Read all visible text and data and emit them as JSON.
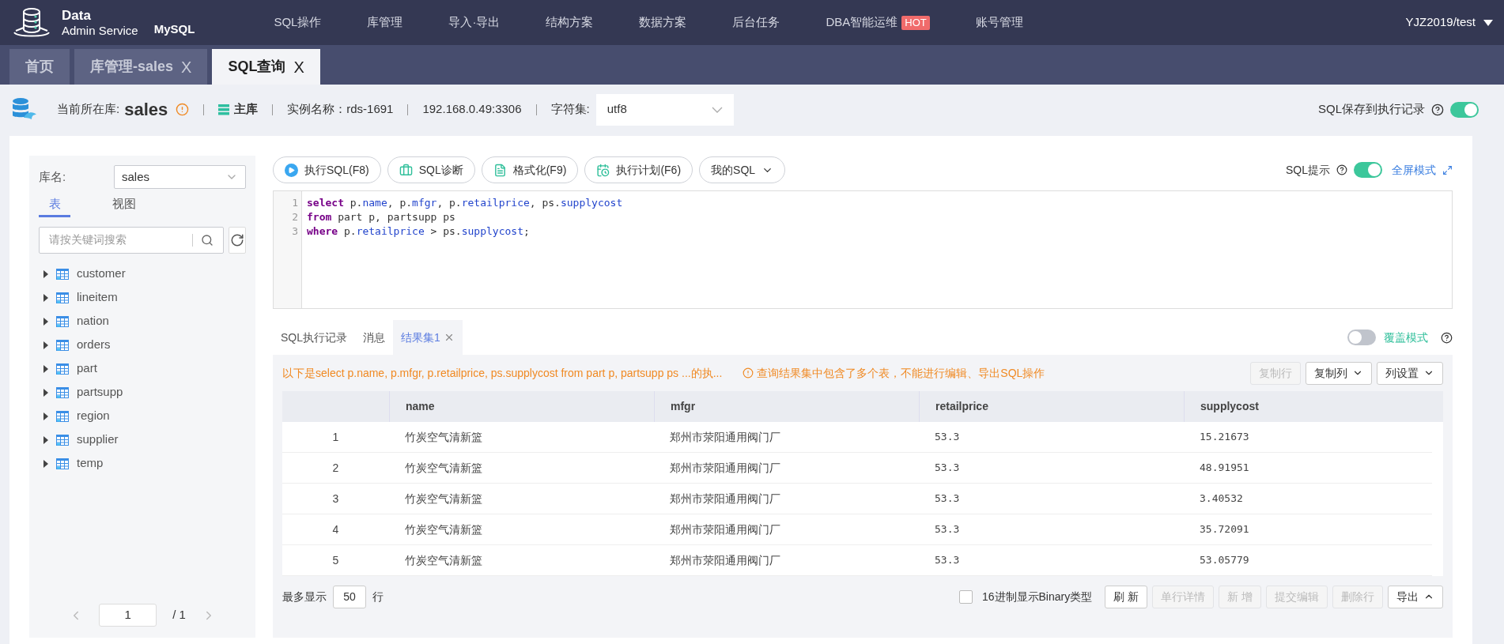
{
  "header": {
    "brand_line1": "Data",
    "brand_line2": "Admin Service",
    "brand_db": "MySQL",
    "menu": [
      {
        "label": "SQL操作"
      },
      {
        "label": "库管理"
      },
      {
        "label": "导入·导出"
      },
      {
        "label": "结构方案"
      },
      {
        "label": "数据方案"
      },
      {
        "label": "后台任务"
      },
      {
        "label": "DBA智能运维",
        "badge": "HOT"
      },
      {
        "label": "账号管理"
      }
    ],
    "user": "YJZ2019/test"
  },
  "page_tabs": [
    {
      "label": "首页",
      "selected": false,
      "closable": false
    },
    {
      "label": "库管理-sales",
      "selected": false,
      "closable": true,
      "close": "X"
    },
    {
      "label": "SQL查询",
      "selected": true,
      "closable": true,
      "close": "X"
    }
  ],
  "info_bar": {
    "db_label": "当前所在库:",
    "db_name": "sales",
    "role": "主库",
    "instance": "实例名称：rds-1691",
    "address": "192.168.0.49:3306",
    "charset_label": "字符集:",
    "charset": "utf8",
    "save_log_label": "SQL保存到执行记录",
    "save_log_on": true
  },
  "sidebar": {
    "db_label": "库名:",
    "db_value": "sales",
    "tabs": [
      {
        "label": "表",
        "selected": true
      },
      {
        "label": "视图",
        "selected": false
      }
    ],
    "search_placeholder": "请按关键词搜索",
    "tables": [
      {
        "name": "customer",
        "expanded": false
      },
      {
        "name": "lineitem",
        "expanded": false
      },
      {
        "name": "nation",
        "expanded": false
      },
      {
        "name": "orders",
        "expanded": false
      },
      {
        "name": "part",
        "expanded": false
      },
      {
        "name": "partsupp",
        "expanded": false
      },
      {
        "name": "region",
        "expanded": false
      },
      {
        "name": "supplier",
        "expanded": false
      },
      {
        "name": "temp",
        "expanded": false
      }
    ],
    "pager": {
      "page": "1",
      "total": "/ 1"
    }
  },
  "toolbar": {
    "buttons": [
      {
        "label": "执行SQL(F8)",
        "dropdown": false
      },
      {
        "label": "SQL诊断",
        "dropdown": false
      },
      {
        "label": "格式化(F9)",
        "dropdown": false
      },
      {
        "label": "执行计划(F6)",
        "dropdown": false
      },
      {
        "label": "我的SQL",
        "dropdown": true
      }
    ],
    "hint_label": "SQL提示",
    "hint_on": true,
    "fullscreen": "全屏模式"
  },
  "editor": {
    "lines": [
      {
        "number": "1",
        "tokens": [
          {
            "kind": "keyword",
            "text": "select"
          },
          {
            "kind": "plain",
            "text": " p."
          },
          {
            "kind": "field",
            "text": "name"
          },
          {
            "kind": "plain",
            "text": ", p."
          },
          {
            "kind": "field",
            "text": "mfgr"
          },
          {
            "kind": "plain",
            "text": ", p."
          },
          {
            "kind": "field",
            "text": "retailprice"
          },
          {
            "kind": "plain",
            "text": ", ps."
          },
          {
            "kind": "field",
            "text": "supplycost"
          }
        ]
      },
      {
        "number": "2",
        "tokens": [
          {
            "kind": "keyword",
            "text": "from"
          },
          {
            "kind": "plain",
            "text": " part p, partsupp ps"
          }
        ]
      },
      {
        "number": "3",
        "tokens": [
          {
            "kind": "keyword",
            "text": "where"
          },
          {
            "kind": "plain",
            "text": " p."
          },
          {
            "kind": "field",
            "text": "retailprice"
          },
          {
            "kind": "plain",
            "text": " > ps."
          },
          {
            "kind": "field",
            "text": "supplycost"
          },
          {
            "kind": "plain",
            "text": ";"
          }
        ]
      }
    ]
  },
  "result_tabs": [
    {
      "label": "SQL执行记录",
      "selected": false,
      "closable": false
    },
    {
      "label": "消息",
      "selected": false,
      "closable": false
    },
    {
      "label": "结果集1",
      "selected": true,
      "closable": true
    }
  ],
  "overwrite_mode": {
    "label": "覆盖模式",
    "on": false
  },
  "result_info": {
    "summary": "以下是select p.name, p.mfgr, p.retailprice, ps.supplycost from part p, partsupp ps ...的执...",
    "warning": "查询结果集中包含了多个表，不能进行编辑、导出SQL操作",
    "actions": [
      {
        "label": "复制行",
        "disabled": true,
        "dropdown": false
      },
      {
        "label": "复制列",
        "disabled": false,
        "dropdown": true
      },
      {
        "label": "列设置",
        "disabled": false,
        "dropdown": true
      }
    ]
  },
  "table": {
    "columns": [
      "",
      "name",
      "mfgr",
      "retailprice",
      "supplycost"
    ],
    "rows": [
      [
        "1",
        "竹炭空气清新篮",
        "郑州市荥阳通用阀门厂",
        "53.3",
        "15.21673"
      ],
      [
        "2",
        "竹炭空气清新篮",
        "郑州市荥阳通用阀门厂",
        "53.3",
        "48.91951"
      ],
      [
        "3",
        "竹炭空气清新篮",
        "郑州市荥阳通用阀门厂",
        "53.3",
        "3.40532"
      ],
      [
        "4",
        "竹炭空气清新篮",
        "郑州市荥阳通用阀门厂",
        "53.3",
        "35.72091"
      ],
      [
        "5",
        "竹炭空气清新篮",
        "郑州市荥阳通用阀门厂",
        "53.3",
        "53.05779"
      ]
    ]
  },
  "footer": {
    "max_label": "最多显示",
    "max_value": "50",
    "max_unit": "行",
    "hex_label": "16进制显示Binary类型",
    "hex_checked": false,
    "buttons": [
      {
        "label": "刷 新",
        "disabled": false,
        "dropdown": false
      },
      {
        "label": "单行详情",
        "disabled": true,
        "dropdown": false
      },
      {
        "label": "新 增",
        "disabled": true,
        "dropdown": false
      },
      {
        "label": "提交编辑",
        "disabled": true,
        "dropdown": false
      },
      {
        "label": "删除行",
        "disabled": true,
        "dropdown": false
      },
      {
        "label": "导出",
        "disabled": false,
        "dropdown": true
      }
    ]
  }
}
